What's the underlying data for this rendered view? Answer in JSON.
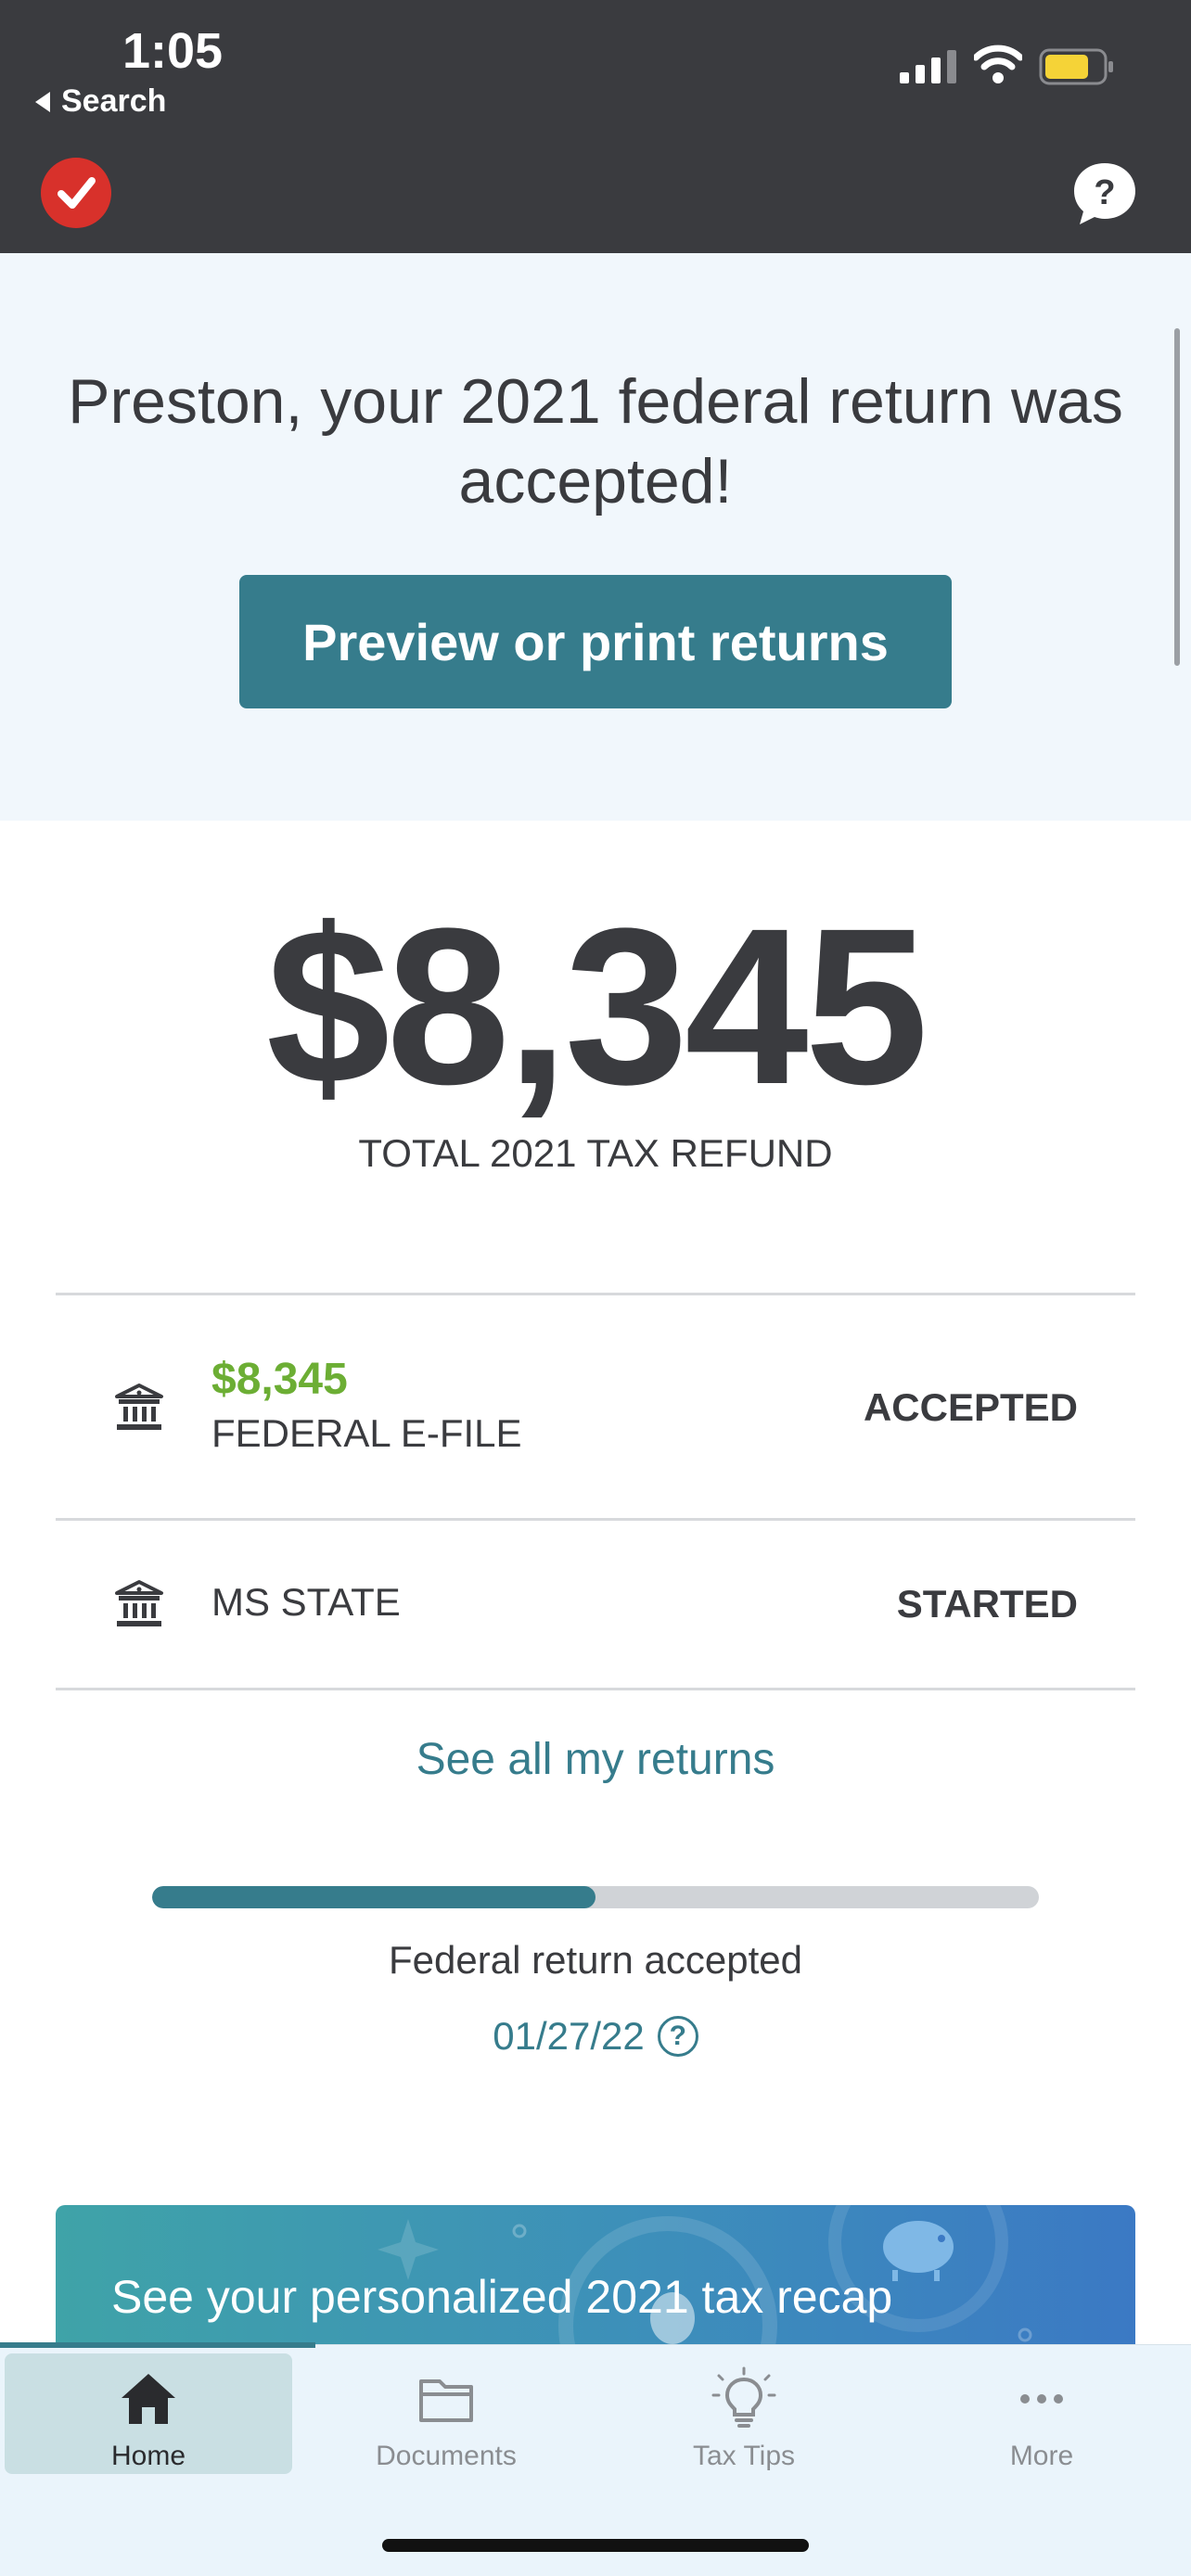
{
  "status_bar": {
    "time": "1:05",
    "back_label": "Search"
  },
  "banner": {
    "headline": "Preston, your 2021 federal return was accepted!",
    "button_label": "Preview or print returns"
  },
  "refund": {
    "amount": "$8,345",
    "label": "TOTAL 2021 TAX REFUND"
  },
  "returns": [
    {
      "amount": "$8,345",
      "label": "FEDERAL E-FILE",
      "status": "ACCEPTED"
    },
    {
      "label": "MS STATE",
      "status": "STARTED"
    }
  ],
  "see_all_label": "See all my returns",
  "progress": {
    "fraction": 0.5,
    "text": "Federal return accepted",
    "date": "01/27/22"
  },
  "recap": {
    "text": "See your personalized 2021 tax recap"
  },
  "tabs": [
    {
      "label": "Home",
      "icon": "home-icon",
      "active": true
    },
    {
      "label": "Documents",
      "icon": "folder-icon",
      "active": false
    },
    {
      "label": "Tax Tips",
      "icon": "lightbulb-icon",
      "active": false
    },
    {
      "label": "More",
      "icon": "more-icon",
      "active": false
    }
  ],
  "colors": {
    "accent": "#367c8c",
    "green": "#6cae34",
    "header": "#3a3b3f",
    "brand_red": "#d8312b"
  }
}
